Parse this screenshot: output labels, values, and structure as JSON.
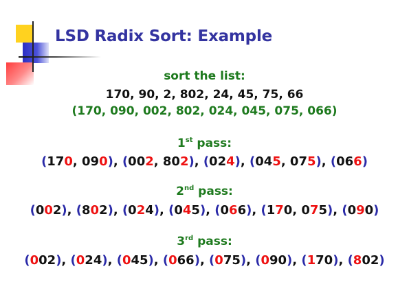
{
  "title": "LSD Radix Sort: Example",
  "intro": {
    "heading": "sort the list:",
    "list": "170, 90, 2, 802, 24, 45, 75, 66",
    "padded": "(170, 090, 002, 802, 024, 045, 075, 066)"
  },
  "passes": [
    {
      "num": "1",
      "suffix": "st",
      "label": "pass:",
      "groups": [
        [
          {
            "p": "17",
            "d": "0"
          },
          {
            "p": "09",
            "d": "0"
          }
        ],
        [
          {
            "p": "00",
            "d": "2"
          },
          {
            "p": "80",
            "d": "2"
          }
        ],
        [
          {
            "p": "02",
            "d": "4"
          }
        ],
        [
          {
            "p": "04",
            "d": "5"
          },
          {
            "p": "07",
            "d": "5"
          }
        ],
        [
          {
            "p": "06",
            "d": "6"
          }
        ]
      ]
    },
    {
      "num": "2",
      "suffix": "nd",
      "label": "pass:",
      "groups": [
        [
          {
            "a": "0",
            "d": "0",
            "s": "2"
          }
        ],
        [
          {
            "a": "8",
            "d": "0",
            "s": "2"
          }
        ],
        [
          {
            "a": "0",
            "d": "2",
            "s": "4"
          }
        ],
        [
          {
            "a": "0",
            "d": "4",
            "s": "5"
          }
        ],
        [
          {
            "a": "0",
            "d": "6",
            "s": "6"
          }
        ],
        [
          {
            "a": "1",
            "d": "7",
            "s": "0"
          },
          {
            "a": "0",
            "d": "7",
            "s": "5"
          }
        ],
        [
          {
            "a": "0",
            "d": "9",
            "s": "0"
          }
        ]
      ]
    },
    {
      "num": "3",
      "suffix": "rd",
      "label": "pass:",
      "groups": [
        [
          {
            "d": "0",
            "s": "02"
          }
        ],
        [
          {
            "d": "0",
            "s": "24"
          }
        ],
        [
          {
            "d": "0",
            "s": "45"
          }
        ],
        [
          {
            "d": "0",
            "s": "66"
          }
        ],
        [
          {
            "d": "0",
            "s": "75"
          }
        ],
        [
          {
            "d": "0",
            "s": "90"
          }
        ],
        [
          {
            "d": "1",
            "s": "70"
          }
        ],
        [
          {
            "d": "8",
            "s": "02"
          }
        ]
      ]
    }
  ],
  "colors": {
    "title": "#3333a0",
    "heading": "#1e7a1e",
    "highlight_digit": "#ee1111",
    "paren": "#2a2aa8"
  }
}
